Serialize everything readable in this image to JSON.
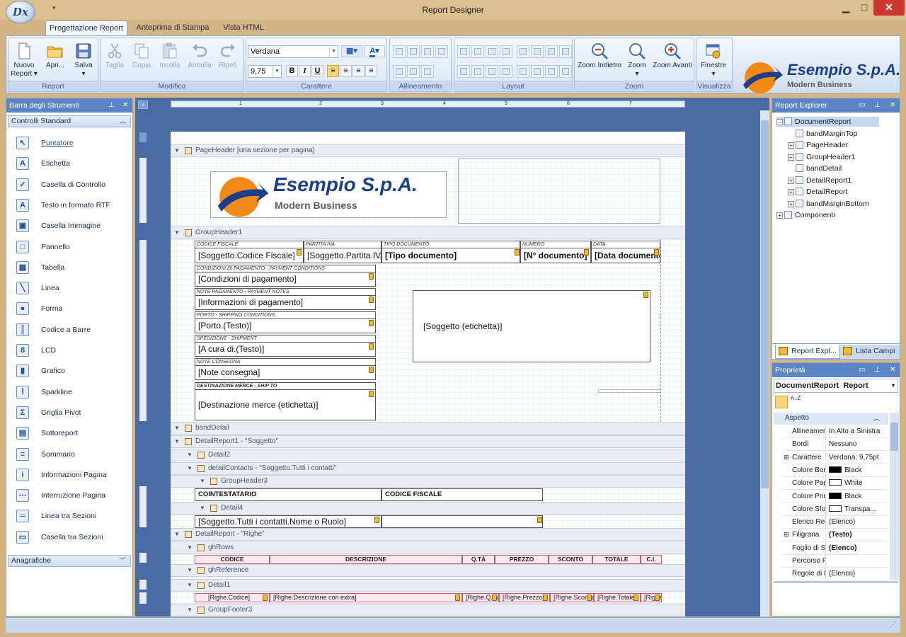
{
  "window": {
    "title": "Report Designer",
    "logo_text": "Dx",
    "qat": "▾"
  },
  "ribbon_tabs": [
    {
      "label": "Progettazione Report",
      "active": true
    },
    {
      "label": "Anteprima di Stampa",
      "active": false
    },
    {
      "label": "Vista HTML",
      "active": false
    }
  ],
  "groups": {
    "report": {
      "label": "Report",
      "new1": "Nuovo",
      "new2": "Report ▾",
      "open": "Apri...",
      "save": "Salva",
      "save_arrow": "▾"
    },
    "modifica": {
      "label": "Modifica",
      "cut": "Taglia",
      "copy": "Copia",
      "paste": "Incolla",
      "undo": "Annulla",
      "redo": "Ripeti"
    },
    "carattere": {
      "label": "Carattere",
      "font": "Verdana",
      "size": "9,75",
      "bold": "B",
      "italic": "I",
      "underline": "U"
    },
    "allineamento": {
      "label": "Allineamento"
    },
    "layout": {
      "label": "Layout"
    },
    "zoom": {
      "label": "Zoom",
      "zoom_out": "Zoom Indietro",
      "zoom": "Zoom",
      "zoom_arrow": "▾",
      "zoom_in": "Zoom Avanti"
    },
    "visualizza": {
      "label": "Visualizza",
      "windows": "Finestre",
      "windows_arrow": "▾"
    }
  },
  "brand": {
    "name": "Esempio S.p.A.",
    "tagline": "Modern Business",
    "colors": {
      "navy": "#1c3f8a",
      "orange": "#f28a1a"
    }
  },
  "toolbox": {
    "title": "Barra degli Strumenti",
    "section": "Controlli Standard",
    "items": [
      {
        "label": "Puntatore",
        "icon": "pointer-icon",
        "glyph": "↖"
      },
      {
        "label": "Etichetta",
        "icon": "label-icon",
        "glyph": "A"
      },
      {
        "label": "Casella di Controllo",
        "icon": "checkbox-icon",
        "glyph": "✓"
      },
      {
        "label": "Testo in formato RTF",
        "icon": "rtf-icon",
        "glyph": "A"
      },
      {
        "label": "Casella Immagine",
        "icon": "picture-icon",
        "glyph": "▣"
      },
      {
        "label": "Pannello",
        "icon": "panel-icon",
        "glyph": "□"
      },
      {
        "label": "Tabella",
        "icon": "table-icon",
        "glyph": "▦"
      },
      {
        "label": "Linea",
        "icon": "line-icon",
        "glyph": "╲"
      },
      {
        "label": "Forma",
        "icon": "shape-icon",
        "glyph": "●"
      },
      {
        "label": "Codice a Barre",
        "icon": "barcode-icon",
        "glyph": "║"
      },
      {
        "label": "LCD",
        "icon": "lcd-icon",
        "glyph": "8"
      },
      {
        "label": "Grafico",
        "icon": "chart-icon",
        "glyph": "▮"
      },
      {
        "label": "Sparkline",
        "icon": "sparkline-icon",
        "glyph": "⌇"
      },
      {
        "label": "Griglia Pivot",
        "icon": "pivot-icon",
        "glyph": "Σ"
      },
      {
        "label": "Sottoreport",
        "icon": "subreport-icon",
        "glyph": "▤"
      },
      {
        "label": "Sommario",
        "icon": "toc-icon",
        "glyph": "≡"
      },
      {
        "label": "Informazioni Pagina",
        "icon": "pageinfo-icon",
        "glyph": "i"
      },
      {
        "label": "Interruzione Pagina",
        "icon": "pagebreak-icon",
        "glyph": "⋯"
      },
      {
        "label": "Linea tra Sezioni",
        "icon": "crossline-icon",
        "glyph": "═"
      },
      {
        "label": "Casella tra Sezioni",
        "icon": "crossbox-icon",
        "glyph": "▭"
      }
    ],
    "section2": "Anagrafiche"
  },
  "designer": {
    "bands": {
      "page_header": "PageHeader [una sezione per pagina]",
      "group_header1": "GroupHeader1",
      "band_detail": "bandDetail",
      "detail_report1": "DetailReport1 - \"Soggetto\"",
      "detail2": "Detail2",
      "detail_contacts": "detailContacts - \"Soggetto.Tutti i contatti\"",
      "group_header3": "GroupHeader3",
      "detail4": "Detail4",
      "detail_report": "DetailReport - \"Righe\"",
      "gh_rows": "ghRows",
      "gh_reference": "ghReference",
      "detail1": "Detail1",
      "group_footer3": "GroupFooter3"
    },
    "header_captions": {
      "cf": "CODICE FISCALE",
      "piva": "PARTITA IVA",
      "tipo": "TIPO DOCUMENTO",
      "num": "NUMERO",
      "data": "DATA"
    },
    "header_fields": {
      "cf": "[Soggetto.Codice Fiscale]",
      "piva": "[Soggetto.Partita IVA]",
      "tipo": "[Tipo documento]",
      "num": "[N° documento]",
      "data": "[Data documento]"
    },
    "left_blocks": [
      {
        "caption": "CONDIZIONI DI PAGAMENTO - PAYMENT CONDITIONS",
        "value": "[Condizioni di pagamento]"
      },
      {
        "caption": "NOTE PAGAMENTO - PAYMENT NOTES",
        "value": "[Informazioni di pagamento]"
      },
      {
        "caption": "PORTO - SHIPPING CONDITIONS",
        "value": "[Porto.(Testo)]"
      },
      {
        "caption": "SPEDIZIONE - SHIPMENT",
        "value": "[A cura di.(Testo)]"
      },
      {
        "caption": "NOTE CONSEGNA",
        "value": "[Note consegna]"
      }
    ],
    "destination": {
      "caption": "DESTINAZIONE MERCE - SHIP TO",
      "value": "[Destinazione merce (etichetta)]"
    },
    "subject_label": "[Soggetto (etichetta)]",
    "contacts": {
      "h1": "COINTESTATARIO",
      "h2": "CODICE FISCALE",
      "value": "[Soggetto.Tutti i contatti.Nome o Ruolo]"
    },
    "row_headers": [
      "CODICE",
      "DESCRIZIONE",
      "Q.TÀ",
      "PREZZO",
      "SCONTO",
      "TOTALE",
      "C.I."
    ],
    "row_cells": [
      "[Righe.Codice]",
      "[Righe.Descrizione con extra]",
      "[Righe.Q.tà]",
      "[Righe.Prezzo]",
      "[Righe.Sconto]",
      "[Righe.Totale]",
      "[Righe.C.I.]"
    ]
  },
  "explorer": {
    "title": "Report Explorer",
    "nodes": [
      "DocumentReport",
      "bandMarginTop",
      "PageHeader",
      "GroupHeader1",
      "bandDetail",
      "DetailReport1",
      "DetailReport",
      "bandMarginBottom",
      "Componenti"
    ],
    "tab1": "Report Expl...",
    "tab2": "Lista Campi"
  },
  "properties": {
    "title": "Proprietà",
    "selector": "DocumentReport  Report",
    "selector_arrow": "▾",
    "sort_icon": "A↓Z",
    "category": "Aspetto",
    "rows": [
      {
        "name": "Allineamento",
        "value": "In Alto a Sinistra"
      },
      {
        "name": "Bordi",
        "value": "Nessuno"
      },
      {
        "name": "Carattere",
        "value": "Verdana; 9,75pt"
      },
      {
        "name": "Colore Bordo",
        "value": "Black",
        "swatch": "#000000"
      },
      {
        "name": "Colore Pagina",
        "value": "White",
        "swatch": "#ffffff"
      },
      {
        "name": "Colore Primo piano",
        "value": "Black",
        "swatch": "#000000"
      },
      {
        "name": "Colore Sfondo",
        "value": "Transpa...",
        "swatch": "#ffffff"
      },
      {
        "name": "Elenco Regole",
        "value": "(Elenco)"
      },
      {
        "name": "Filigrana",
        "value": "(Testo)"
      },
      {
        "name": "Foglio di Stile",
        "value": "(Elenco)"
      },
      {
        "name": "Percorso Foglio",
        "value": ""
      },
      {
        "name": "Regole di Formattazione",
        "value": "(Elenco)"
      }
    ]
  }
}
